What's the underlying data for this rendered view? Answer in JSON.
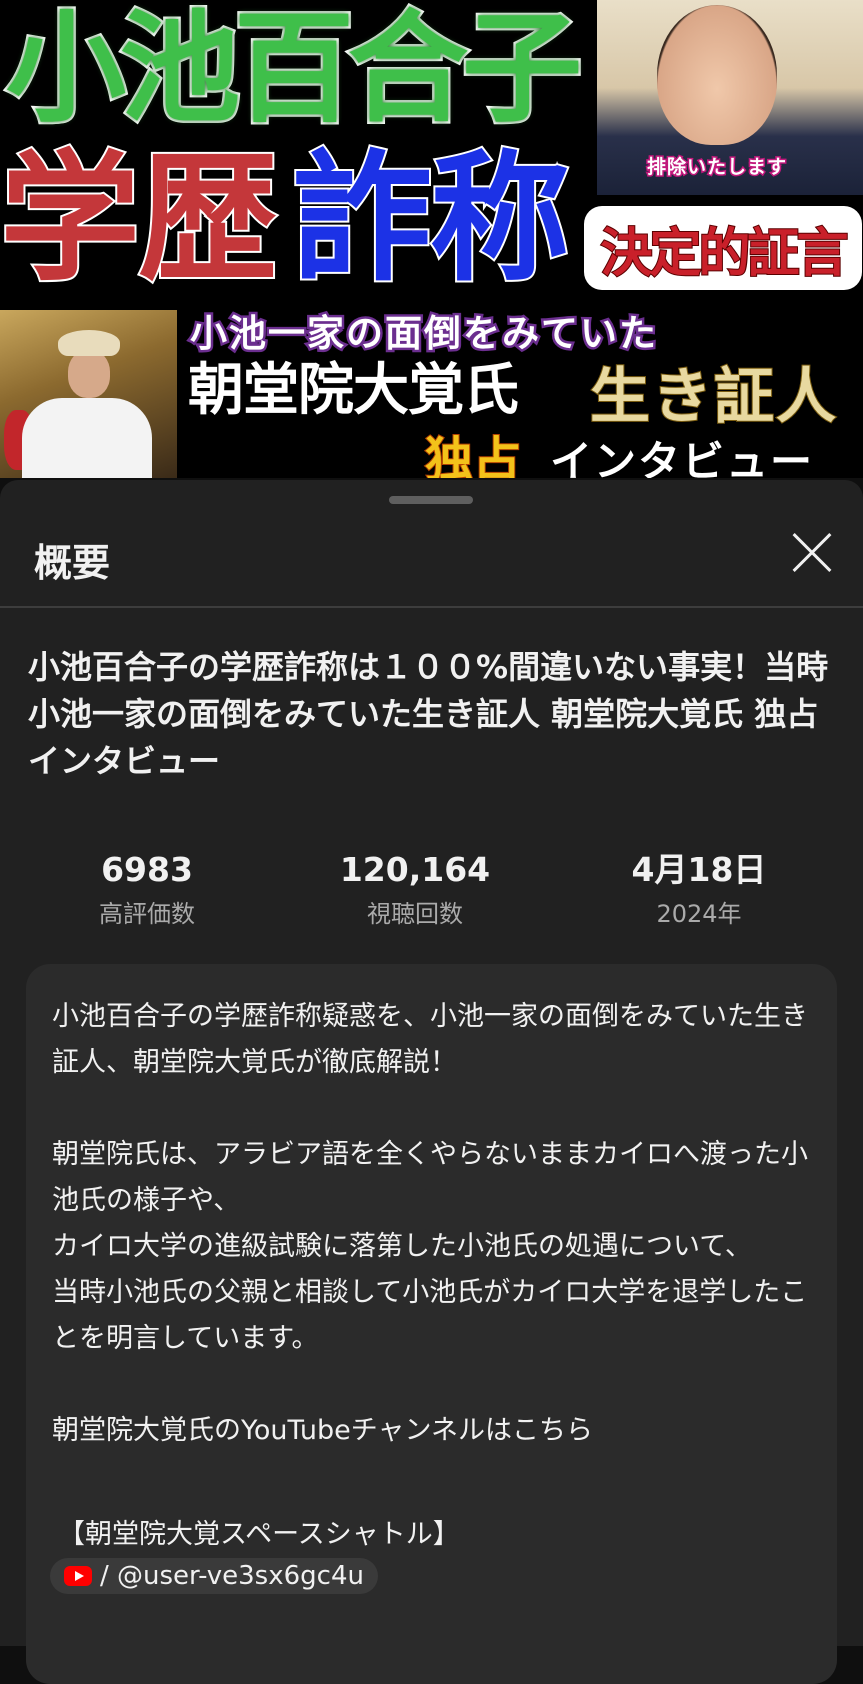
{
  "thumbnail": {
    "title_line1": "小池百合子",
    "word_gakureki": "学歴",
    "word_sasho": "詐称",
    "photo_caption": "排除いたします",
    "badge": "決定的証言",
    "line_family": "小池一家の面倒をみていた",
    "line_name": "朝堂院大覚氏",
    "line_witness": "生き証人",
    "line_exclusive": "独占",
    "line_interview": "インタビュー",
    "colors": {
      "green": "#3fbf4a",
      "red": "#c4373a",
      "blue": "#1c32e6",
      "gold": "#f3c21a"
    }
  },
  "sheet": {
    "title": "概要",
    "close_icon": "close-icon",
    "video_title": "小池百合子の学歴詐称は１００%間違いない事実！当時小池一家の面倒をみていた生き証人 朝堂院大覚氏 独占インタビュー",
    "stats": [
      {
        "value": "6983",
        "label": "高評価数"
      },
      {
        "value": "120,164",
        "label": "視聴回数"
      },
      {
        "value": "4月18日",
        "label": "2024年"
      }
    ],
    "description": "小池百合子の学歴詐称疑惑を、小池一家の面倒をみていた生き証人、朝堂院大覚氏が徹底解説！\n\n朝堂院氏は、アラビア語を全くやらないままカイロへ渡った小池氏の様子や、\nカイロ大学の進級試験に落第した小池氏の処遇について、\n当時小池氏の父親と相談して小池氏がカイロ大学を退学したことを明言しています。\n\n朝堂院大覚氏のYouTubeチャンネルはこちら",
    "channel_label": "【朝堂院大覚スペースシャトル】",
    "channel_handle": "/ @user-ve3sx6gc4u",
    "channel_icon": "youtube-icon"
  }
}
